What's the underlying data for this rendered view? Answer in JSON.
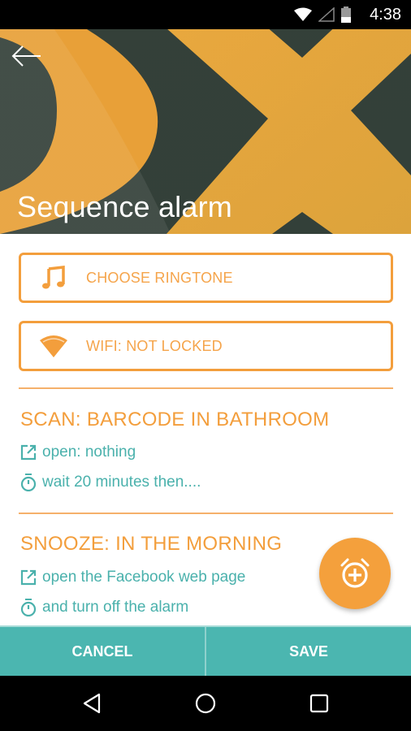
{
  "status_bar": {
    "time": "4:38",
    "icons": [
      "wifi-icon",
      "cell-signal-icon",
      "battery-icon"
    ]
  },
  "header": {
    "title": "Sequence alarm",
    "back_icon": "arrow-back-icon"
  },
  "buttons": {
    "ringtone": {
      "label": "CHOOSE RINGTONE",
      "icon": "music-note-icon"
    },
    "wifi": {
      "label": "WIFI: NOT LOCKED",
      "icon": "wifi-icon"
    }
  },
  "steps": [
    {
      "title": "SCAN: BARCODE IN BATHROOM",
      "lines": [
        {
          "icon": "open-external-icon",
          "text": "open: nothing"
        },
        {
          "icon": "timer-icon",
          "text": "wait 20 minutes then...."
        }
      ]
    },
    {
      "title": "SNOOZE: IN THE MORNING",
      "lines": [
        {
          "icon": "open-external-icon",
          "text": "open the Facebook web page"
        },
        {
          "icon": "timer-icon",
          "text": "and turn off the alarm"
        }
      ]
    }
  ],
  "fab": {
    "icon": "add-alarm-icon"
  },
  "actions": {
    "cancel": "CANCEL",
    "save": "SAVE"
  },
  "nav": [
    "back-icon",
    "home-icon",
    "recents-icon"
  ],
  "colors": {
    "accent": "#f39e3c",
    "teal": "#4bb6b0",
    "dark": "#2f3f3b"
  }
}
